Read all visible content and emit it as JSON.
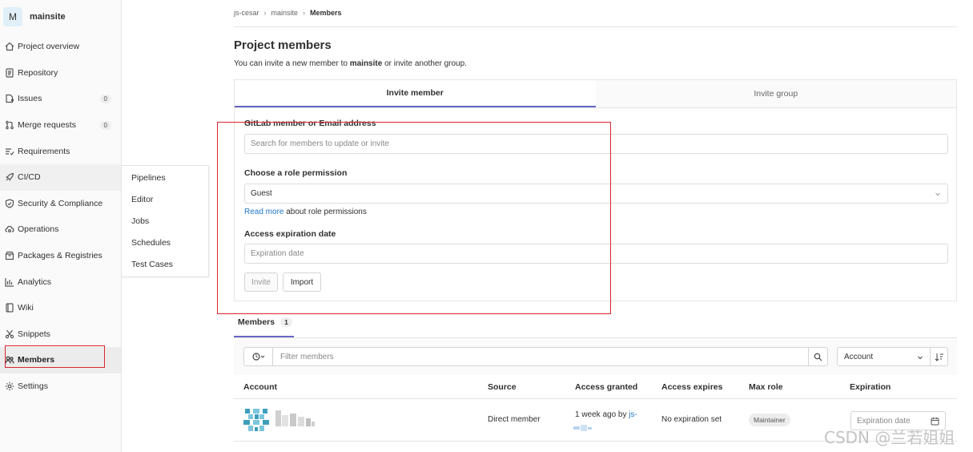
{
  "project": {
    "avatar_letter": "M",
    "name": "mainsite"
  },
  "sidebar": {
    "items": [
      {
        "label": "Project overview",
        "icon": "home-icon"
      },
      {
        "label": "Repository",
        "icon": "doc-icon"
      },
      {
        "label": "Issues",
        "icon": "issues-icon",
        "count": "0"
      },
      {
        "label": "Merge requests",
        "icon": "merge-request-icon",
        "count": "0"
      },
      {
        "label": "Requirements",
        "icon": "requirements-icon"
      },
      {
        "label": "CI/CD",
        "icon": "rocket-icon"
      },
      {
        "label": "Security & Compliance",
        "icon": "shield-icon"
      },
      {
        "label": "Operations",
        "icon": "cloud-gear-icon"
      },
      {
        "label": "Packages & Registries",
        "icon": "package-icon"
      },
      {
        "label": "Analytics",
        "icon": "chart-icon"
      },
      {
        "label": "Wiki",
        "icon": "book-icon"
      },
      {
        "label": "Snippets",
        "icon": "scissors-icon"
      },
      {
        "label": "Members",
        "icon": "users-icon"
      },
      {
        "label": "Settings",
        "icon": "gear-icon"
      }
    ],
    "flyout": [
      "Pipelines",
      "Editor",
      "Jobs",
      "Schedules",
      "Test Cases"
    ]
  },
  "breadcrumb": [
    "js-cesar",
    "mainsite",
    "Members"
  ],
  "page": {
    "title": "Project members",
    "subtitle_pre": "You can invite a new member to ",
    "subtitle_bold": "mainsite",
    "subtitle_post": " or invite another group."
  },
  "tabs": [
    "Invite member",
    "Invite group"
  ],
  "form": {
    "member_label": "GitLab member or Email address",
    "member_placeholder": "Search for members to update or invite",
    "role_label": "Choose a role permission",
    "role_value": "Guest",
    "help_link": "Read more",
    "help_text": " about role permissions",
    "expiration_label": "Access expiration date",
    "expiration_placeholder": "Expiration date",
    "invite_button": "Invite",
    "import_button": "Import"
  },
  "members": {
    "tab_label": "Members",
    "count": "1",
    "filter_placeholder": "Filter members",
    "sort_value": "Account",
    "columns": [
      "Account",
      "Source",
      "Access granted",
      "Access expires",
      "Max role",
      "Expiration"
    ],
    "rows": [
      {
        "source": "Direct member",
        "granted_text": "1 week ago by ",
        "granted_by": "js-",
        "expires": "No expiration set",
        "role": "Maintainer",
        "expiration_placeholder": "Expiration date"
      }
    ]
  },
  "watermark": "CSDN @兰若姐姐",
  "colors": {
    "accent": "#6666c4",
    "link": "#1f75cb",
    "annotation": "#d9272e"
  }
}
